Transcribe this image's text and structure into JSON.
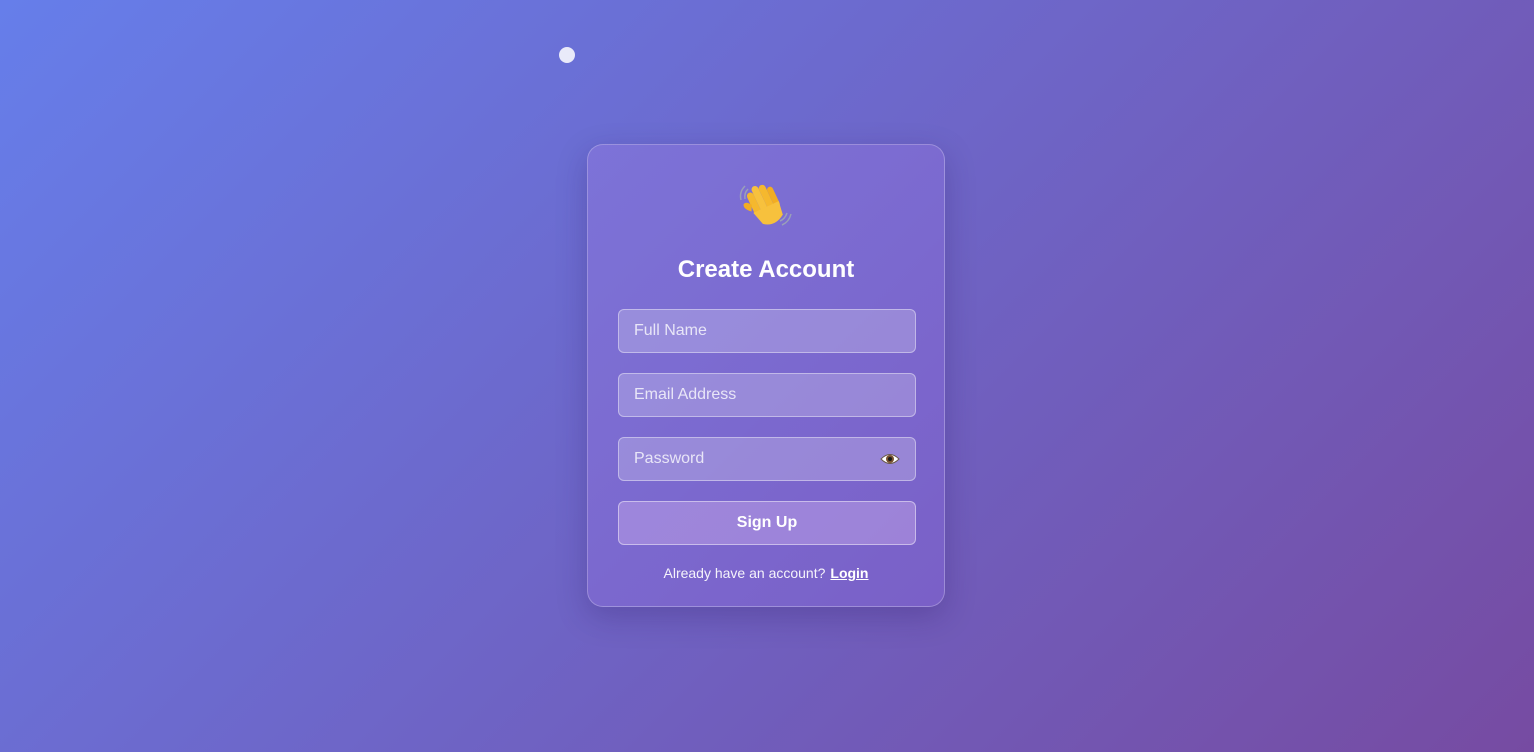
{
  "page": {
    "background_gradient": [
      "#667eea",
      "#764ba2"
    ]
  },
  "card": {
    "icon": "waving-hand-icon",
    "title": "Create Account"
  },
  "form": {
    "full_name_placeholder": "Full Name",
    "email_placeholder": "Email Address",
    "password_placeholder": "Password",
    "password_toggle_icon": "eye-icon",
    "submit_label": "Sign Up"
  },
  "footer": {
    "prompt": "Already have an account?",
    "login_link": "Login"
  }
}
